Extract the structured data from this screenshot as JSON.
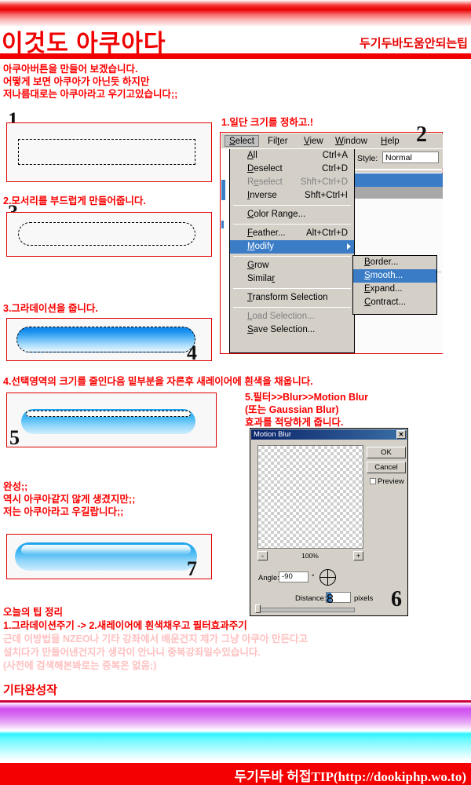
{
  "header": {
    "title": "이것도 아쿠아다",
    "right_label": "두기두바도움안되는팁"
  },
  "intro": {
    "line1": "아쿠아버튼을 만들어 보겠습니다.",
    "line2": "어떻게 보면 아쿠아가 아닌듯 하지만",
    "line3": "저나름대로는 아쿠아라고 우기고있습니다;;"
  },
  "steps": {
    "num1": "1",
    "num2": "2",
    "num3": "3",
    "num4": "4",
    "num5": "5",
    "num6": "6",
    "num7": "7",
    "caption1": "1.일단 크기를 정하고.!",
    "caption2": "2.모서리를 부드럽게 만들어줍니다.",
    "caption3": "3.그라데이션을 줍니다.",
    "caption4": "4.선택영역의 크기를 줄인다음 밑부분을 자른후 새레이어에 흰색을 채웁니다.",
    "caption5_l1": "5.필터>>Blur>>Motion Blur",
    "caption5_l2": "(또는 Gaussian Blur)",
    "caption5_l3": "효과를 적당하게 줍니다."
  },
  "result": {
    "line1": "완성;;",
    "line2": "역시 아쿠아같지 않게 생겼지만;;",
    "line3": "저는 아쿠아라고 우길랍니다;;"
  },
  "photoshop": {
    "menubar": [
      {
        "label": "Select",
        "mnemonic": "S",
        "active": true
      },
      {
        "label": "Filter",
        "mnemonic": "t",
        "active": false
      },
      {
        "label": "View",
        "mnemonic": "V",
        "active": false
      },
      {
        "label": "Window",
        "mnemonic": "W",
        "active": false
      },
      {
        "label": "Help",
        "mnemonic": "H",
        "active": false
      }
    ],
    "options": {
      "style_label": "Style:",
      "style_value": "Normal"
    },
    "select_menu": [
      {
        "label": "All",
        "accel": "Ctrl+A",
        "state": "normal"
      },
      {
        "label": "Deselect",
        "accel": "Ctrl+D",
        "state": "normal"
      },
      {
        "label": "Reselect",
        "accel": "Shft+Ctrl+D",
        "state": "disabled"
      },
      {
        "label": "Inverse",
        "accel": "Shft+Ctrl+I",
        "state": "normal"
      },
      {
        "label": "Color Range...",
        "accel": "",
        "state": "normal"
      },
      {
        "label": "Feather...",
        "accel": "Alt+Ctrl+D",
        "state": "normal"
      },
      {
        "label": "Modify",
        "accel": "",
        "state": "highlighted",
        "submenu": true
      },
      {
        "label": "Grow",
        "accel": "",
        "state": "normal"
      },
      {
        "label": "Similar",
        "accel": "",
        "state": "normal"
      },
      {
        "label": "Transform Selection",
        "accel": "",
        "state": "normal"
      },
      {
        "label": "Load Selection...",
        "accel": "",
        "state": "disabled"
      },
      {
        "label": "Save Selection...",
        "accel": "",
        "state": "normal"
      }
    ],
    "modify_submenu": [
      {
        "label": "Border...",
        "state": "normal"
      },
      {
        "label": "Smooth...",
        "state": "highlighted"
      },
      {
        "label": "Expand...",
        "state": "normal"
      },
      {
        "label": "Contract...",
        "state": "normal"
      }
    ]
  },
  "motion_blur": {
    "title": "Motion Blur",
    "close_label": "✕",
    "ok_label": "OK",
    "cancel_label": "Cancel",
    "preview_label": "Preview",
    "preview_checked": "✔",
    "zoom_out": "-",
    "zoom_in": "+",
    "zoom_level": "100%",
    "angle_label": "Angle:",
    "angle_value": "-90",
    "degree_symbol": "°",
    "distance_label": "Distance:",
    "distance_value": "8",
    "distance_units": "pixels"
  },
  "summary": {
    "heading": "오늘의 팁 정리",
    "recipe": "1.그라데이션주기 -> 2.새레이어에 흰색채우고 필터효과주기",
    "note1": "근데 이방법을 NZEO나 기타 강좌에서 배운건지 제가 그냥 아쿠아 만든다고",
    "note2": "설치다가 만들어낸건지가 생각이 안나니 중복강좌일수있습니다.",
    "note3": "(사전에 검색해본봐로는 중복은 없음;)",
    "etc_title": "기타완성작"
  },
  "footer": {
    "text": "두기두바 허접TIP(http://dookiphp.wo.to)"
  },
  "colors": {
    "brand_red": "#f00000",
    "accent_blue": "#0c80e8",
    "highlight": "#3a7cc6",
    "chrome": "#d4d0c8"
  }
}
